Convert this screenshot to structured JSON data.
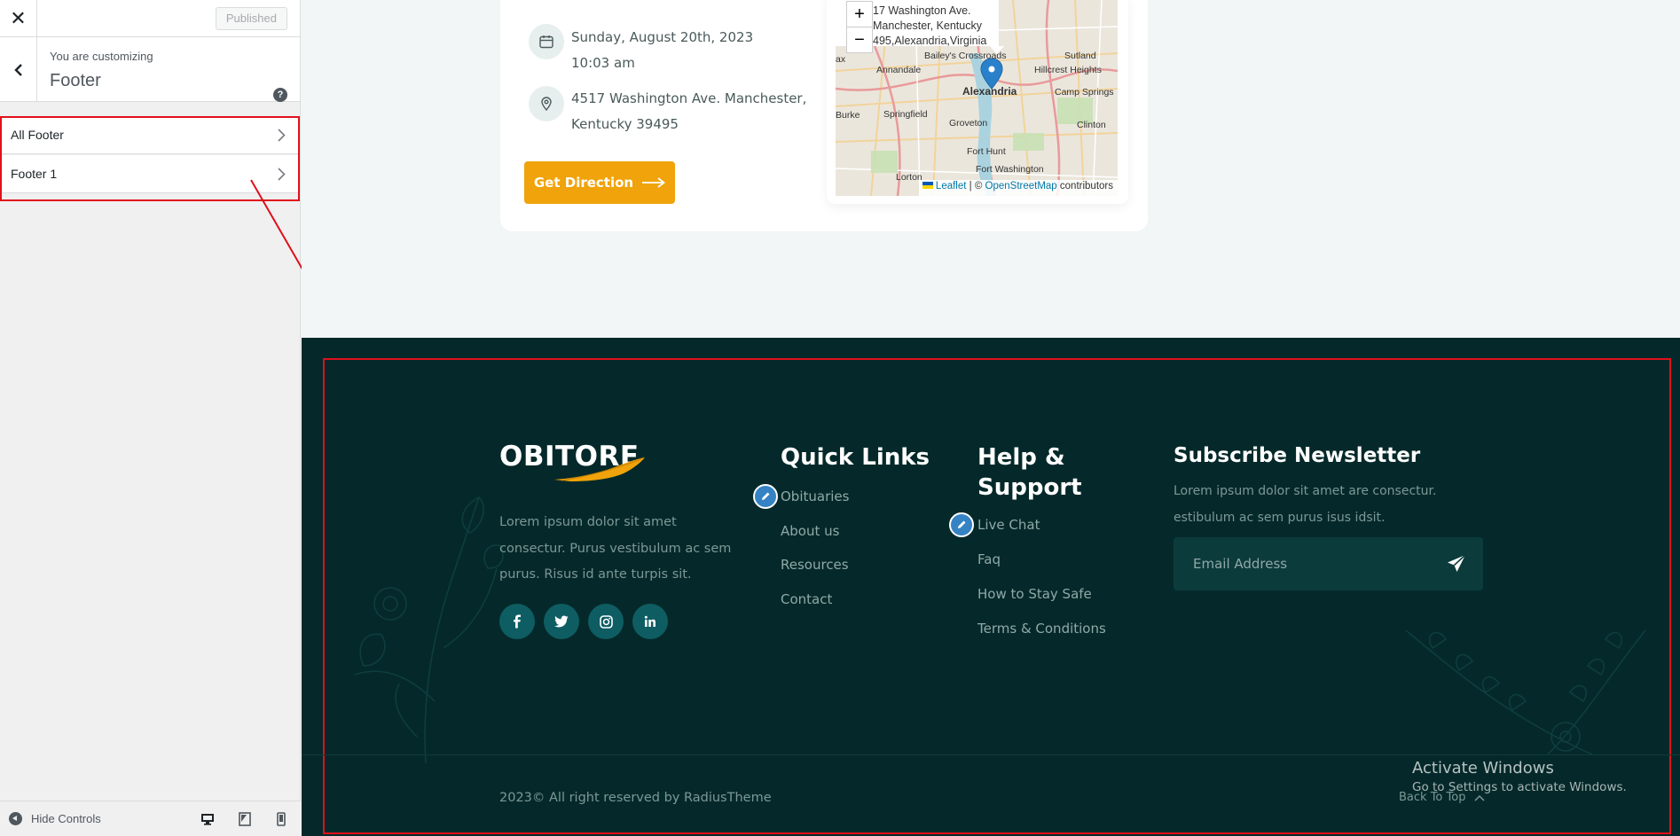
{
  "sidebar": {
    "published_label": "Published",
    "customizing_label": "You are customizing",
    "section_title": "Footer",
    "items": [
      {
        "label": "All Footer"
      },
      {
        "label": "Footer 1"
      }
    ],
    "hide_controls_label": "Hide Controls"
  },
  "event": {
    "date_line1": "Sunday, August 20th, 2023",
    "date_line2": "10:03 am",
    "address_line1": "4517 Washington Ave. Manchester,",
    "address_line2": "Kentucky 39495",
    "button_label": "Get Direction"
  },
  "map": {
    "popup_line1": "17 Washington Ave. Manchester, Kentucky",
    "popup_line2": "495,Alexandria,Virginia",
    "zoom_in": "+",
    "zoom_out": "−",
    "attrib_leaflet": "Leaflet",
    "attrib_sep": "| ©",
    "attrib_osm": "OpenStreetMap",
    "attrib_contrib": "contributors",
    "places": [
      "Bailey's Crossroads",
      "Sutland",
      "Annandale",
      "Hillcrest Heights",
      "Alexandria",
      "Camp Springs",
      "Springfield",
      "Burke",
      "Groveton",
      "Clinton",
      "Fort Hunt",
      "Fort Washington",
      "Lorton",
      "ax"
    ]
  },
  "footer": {
    "logo_text": "OBITORE",
    "about": [
      "Lorem ipsum dolor sit amet",
      "consectur. Purus vestibulum ac sem",
      "purus. Risus id ante turpis sit."
    ],
    "social": [
      "f",
      "t",
      "ig",
      "in"
    ],
    "quick_links_title": "Quick Links",
    "quick_links": [
      "Obituaries",
      "About us",
      "Resources",
      "Contact"
    ],
    "help_title_line1": "Help &",
    "help_title_line2": "Support",
    "help_links": [
      "Live Chat",
      "Faq",
      "How to Stay Safe",
      "Terms & Conditions"
    ],
    "newsletter_title": "Subscribe Newsletter",
    "newsletter_text": [
      "Lorem ipsum dolor sit amet are consectur.",
      "estibulum ac sem purus isus idsit."
    ],
    "email_placeholder": "Email Address",
    "copyright": "2023© All right reserved by RadiusTheme",
    "back_to_top": "Back To Top"
  },
  "watermark": {
    "line1": "Activate Windows",
    "line2": "Go to Settings to activate Windows."
  },
  "colors": {
    "footer_bg": "#05292a",
    "accent": "#f0a30a",
    "highlight": "#e0101a",
    "social_bg": "#0e5d63"
  }
}
